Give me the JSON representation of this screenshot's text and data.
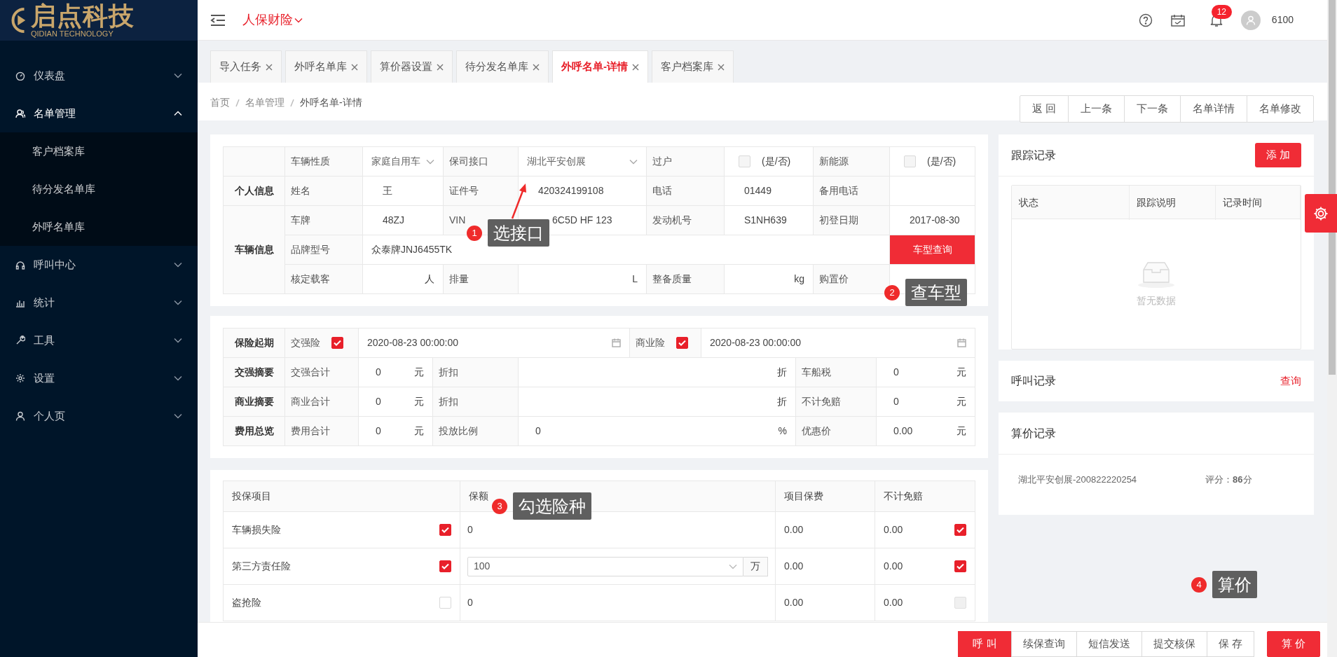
{
  "header": {
    "logo": "启点科技",
    "logo_subtitle": "QIDIAN TECHNOLOGY",
    "company": "人保财险",
    "notification_count": "12",
    "user": "6100"
  },
  "sidebar": {
    "items": [
      {
        "label": "仪表盘",
        "kind": "dashboard",
        "expanded": false
      },
      {
        "label": "名单管理",
        "kind": "people",
        "expanded": true,
        "children": [
          {
            "label": "客户档案库"
          },
          {
            "label": "待分发名单库"
          },
          {
            "label": "外呼名单库"
          }
        ]
      },
      {
        "label": "呼叫中心",
        "kind": "headset",
        "expanded": false
      },
      {
        "label": "统计",
        "kind": "chart",
        "expanded": false
      },
      {
        "label": "工具",
        "kind": "wrench",
        "expanded": false
      },
      {
        "label": "设置",
        "kind": "gear",
        "expanded": false
      },
      {
        "label": "个人页",
        "kind": "person",
        "expanded": false
      }
    ]
  },
  "tabs": [
    {
      "label": "导入任务",
      "selected": false
    },
    {
      "label": "外呼名单库",
      "selected": false
    },
    {
      "label": "算价器设置",
      "selected": false
    },
    {
      "label": "待分发名单库",
      "selected": false
    },
    {
      "label": "外呼名单-详情",
      "selected": true
    },
    {
      "label": "客户档案库",
      "selected": false
    }
  ],
  "breadcrumb": [
    "首页",
    "名单管理",
    "外呼名单-详情"
  ],
  "toolbar_buttons": [
    "返 回",
    "上一条",
    "下一条",
    "名单详情",
    "名单修改"
  ],
  "vehicle_info": {
    "sections": [
      {
        "rows": [
          {
            "cells": [
              {
                "kind": "label",
                "text": "车辆性质"
              },
              {
                "kind": "select",
                "text": "家庭自用车"
              },
              {
                "kind": "label",
                "text": "保司接口"
              },
              {
                "kind": "select",
                "text": "湖北平安创展"
              },
              {
                "kind": "label",
                "text": "过户"
              },
              {
                "kind": "check",
                "checked": false,
                "text": "(是/否)"
              },
              {
                "kind": "label",
                "text": "新能源"
              },
              {
                "kind": "check",
                "checked": false,
                "text": "(是/否)"
              }
            ]
          }
        ]
      },
      {
        "title": "个人信息",
        "rows": [
          {
            "cells": [
              {
                "kind": "label",
                "text": "姓名"
              },
              {
                "kind": "value",
                "text": "王"
              },
              {
                "kind": "label",
                "text": "证件号"
              },
              {
                "kind": "value",
                "text": "420324199108"
              },
              {
                "kind": "label",
                "text": "电话"
              },
              {
                "kind": "value",
                "text": "01449"
              },
              {
                "kind": "label",
                "text": "备用电话"
              },
              {
                "kind": "value"
              }
            ]
          }
        ]
      },
      {
        "title": "车辆信息",
        "rows": [
          {
            "cells": [
              {
                "kind": "label",
                "text": "车牌"
              },
              {
                "kind": "value",
                "text": "48ZJ"
              },
              {
                "kind": "label",
                "text": "VIN"
              },
              {
                "kind": "value",
                "text": "6C5D HF 123"
              },
              {
                "kind": "label",
                "text": "发动机号"
              },
              {
                "kind": "value",
                "text": "S1NH639"
              },
              {
                "kind": "label",
                "text": "初登日期"
              },
              {
                "kind": "value",
                "text": "2017-08-30"
              }
            ]
          },
          {
            "cells": [
              {
                "kind": "label",
                "text": "品牌型号"
              },
              {
                "kind": "wide",
                "text": "众泰牌JNJ6455TK",
                "colspan": 6
              },
              {
                "kind": "button",
                "text": "车型查询"
              }
            ]
          },
          {
            "cells": [
              {
                "kind": "label",
                "text": "核定载客"
              },
              {
                "kind": "unit",
                "unit": "人"
              },
              {
                "kind": "label",
                "text": "排量"
              },
              {
                "kind": "unit",
                "unit": "L"
              },
              {
                "kind": "label",
                "text": "整备质量"
              },
              {
                "kind": "unit",
                "unit": "kg"
              },
              {
                "kind": "label",
                "text": "购置价"
              },
              {
                "kind": "value"
              }
            ]
          }
        ]
      }
    ]
  },
  "coverage": {
    "start_row": {
      "title": "保险起期",
      "items": [
        {
          "label": "交强险",
          "checked": true,
          "date": "2020-08-23 00:00:00"
        },
        {
          "label": "商业险",
          "checked": true,
          "date": "2020-08-23 00:00:00"
        }
      ]
    },
    "rows": [
      {
        "title": "交强摘要",
        "cells": [
          {
            "kind": "label",
            "text": "交强合计"
          },
          {
            "kind": "amount",
            "value": "0",
            "unit": "元"
          },
          {
            "kind": "label",
            "text": "折扣"
          },
          {
            "kind": "amount",
            "unit": "折"
          },
          {
            "kind": "label",
            "text": "车船税"
          },
          {
            "kind": "amount",
            "value": "0",
            "unit": "元"
          }
        ]
      },
      {
        "title": "商业摘要",
        "cells": [
          {
            "kind": "label",
            "text": "商业合计"
          },
          {
            "kind": "amount",
            "value": "0",
            "unit": "元"
          },
          {
            "kind": "label",
            "text": "折扣"
          },
          {
            "kind": "amount",
            "unit": "折"
          },
          {
            "kind": "label",
            "text": "不计免赔"
          },
          {
            "kind": "amount",
            "value": "0",
            "unit": "元"
          }
        ]
      },
      {
        "title": "费用总览",
        "cells": [
          {
            "kind": "label",
            "text": "费用合计"
          },
          {
            "kind": "amount",
            "value": "0",
            "unit": "元"
          },
          {
            "kind": "label",
            "text": "投放比例"
          },
          {
            "kind": "amount",
            "value": "0",
            "unit": "%"
          },
          {
            "kind": "label",
            "text": "优惠价"
          },
          {
            "kind": "amount",
            "value": "0.00",
            "unit": "元"
          }
        ]
      }
    ]
  },
  "items_table": {
    "columns": [
      "投保项目",
      "保额",
      "项目保费",
      "不计免赔"
    ],
    "rows": [
      {
        "name": "车辆损失险",
        "checked": true,
        "kind": "text",
        "amount": "0",
        "premium": "0.00",
        "deductible": "0.00",
        "deductible_checked": true,
        "deductible_disabled": false
      },
      {
        "name": "第三方责任险",
        "checked": true,
        "kind": "select",
        "amount": "100",
        "unit": "万",
        "premium": "0.00",
        "deductible": "0.00",
        "deductible_checked": true,
        "deductible_disabled": false
      },
      {
        "name": "盗抢险",
        "checked": false,
        "kind": "text",
        "amount": "0",
        "premium": "0.00",
        "deductible": "0.00",
        "deductible_checked": false,
        "deductible_disabled": true
      }
    ]
  },
  "tracking": {
    "title": "跟踪记录",
    "add_button": "添 加",
    "columns": [
      "状态",
      "跟踪说明",
      "记录时间"
    ],
    "empty_text": "暂无数据"
  },
  "calls": {
    "title": "呼叫记录",
    "link": "查询"
  },
  "pricing": {
    "title": "算价记录",
    "records": [
      {
        "name": "湖北平安创展-200822220254",
        "score": "评分：**86**分"
      }
    ]
  },
  "annotations": [
    {
      "number": "1",
      "text": "选接口",
      "kind": "arrow"
    },
    {
      "number": "2",
      "text": "查车型",
      "kind": "plain"
    },
    {
      "number": "3",
      "text": "勾选险种",
      "kind": "plain"
    },
    {
      "number": "4",
      "text": "算价",
      "kind": "plain"
    }
  ],
  "footer_buttons": [
    {
      "label": "呼 叫",
      "kind": "primary"
    },
    {
      "label": "续保查询",
      "kind": "default"
    },
    {
      "label": "短信发送",
      "kind": "default"
    },
    {
      "label": "提交核保",
      "kind": "default"
    },
    {
      "label": "保 存",
      "kind": "default"
    },
    {
      "label": "算 价",
      "kind": "accent"
    }
  ]
}
